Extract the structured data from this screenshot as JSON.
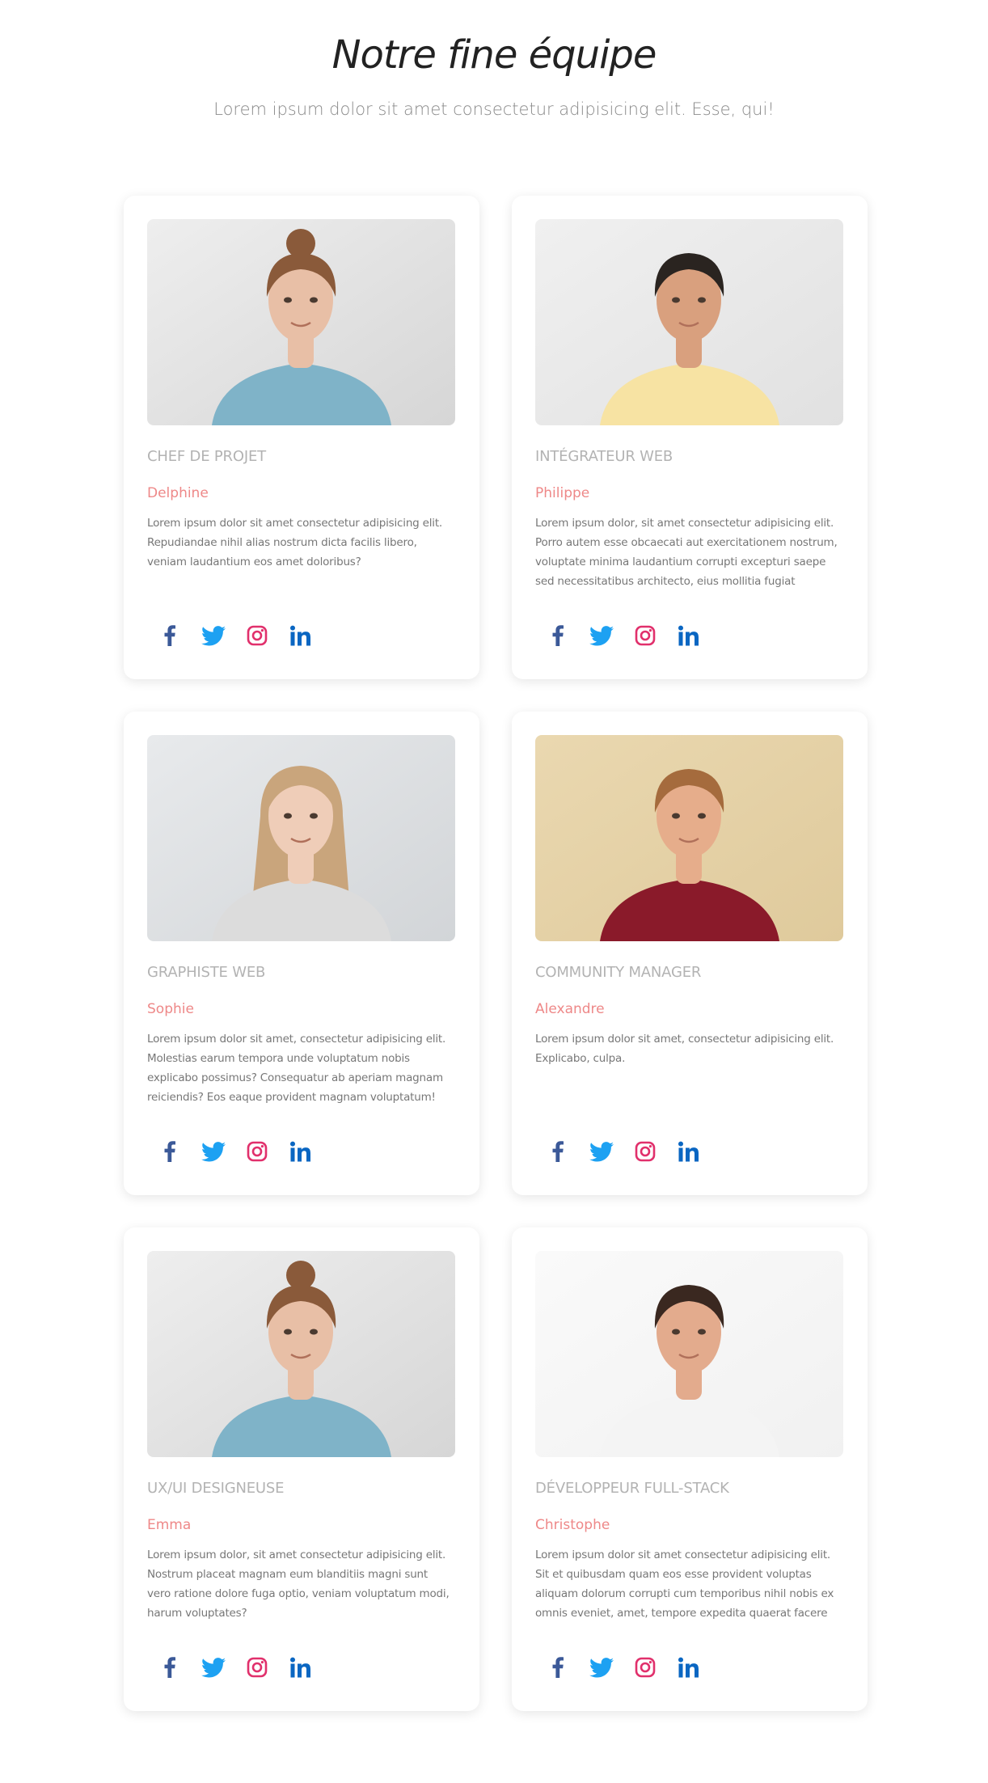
{
  "header": {
    "title": "Notre fine équipe",
    "subtitle": "Lorem ipsum dolor sit amet consectetur adipisicing elit. Esse, qui!"
  },
  "colors": {
    "role": "#b3b3b3",
    "name": "#ee8888",
    "facebook": "#3b5998",
    "twitter": "#1da1f2",
    "instagram": "#e1306c",
    "linkedin": "#0a66c2"
  },
  "social_icons": [
    "facebook-icon",
    "twitter-icon",
    "instagram-icon",
    "linkedin-icon"
  ],
  "members": [
    {
      "role": "Chef de projet",
      "name": "Delphine",
      "description": "Lorem ipsum dolor sit amet consectetur adipisicing elit. Repudiandae nihil alias nostrum dicta facilis libero, veniam laudantium eos amet doloribus?",
      "photo": "woman-portrait-bun"
    },
    {
      "role": "Intégrateur web",
      "name": "Philippe",
      "description": "Lorem ipsum dolor, sit amet consectetur adipisicing elit. Porro autem esse obcaecati aut exercitationem nostrum, voluptate minima laudantium corrupti excepturi saepe sed necessitatibus architecto, eius mollitia fugiat",
      "photo": "man-portrait-yellow-shirt"
    },
    {
      "role": "Graphiste web",
      "name": "Sophie",
      "description": "Lorem ipsum dolor sit amet, consectetur adipisicing elit. Molestias earum tempora unde voluptatum nobis explicabo possimus? Consequatur ab aperiam magnam reiciendis? Eos eaque provident magnam voluptatum!",
      "photo": "woman-portrait-long-hair"
    },
    {
      "role": "Community manager",
      "name": "Alexandre",
      "description": "Lorem ipsum dolor sit amet, consectetur adipisicing elit. Explicabo, culpa.",
      "photo": "man-portrait-red-shirt"
    },
    {
      "role": "UX/UI designeuse",
      "name": "Emma",
      "description": "Lorem ipsum dolor, sit amet consectetur adipisicing elit. Nostrum placeat magnam eum blanditiis magni sunt vero ratione dolore fuga optio, veniam voluptatum modi, harum voluptates?",
      "photo": "woman-portrait-bun"
    },
    {
      "role": "Développeur full-stack",
      "name": "Christophe",
      "description": "Lorem ipsum dolor sit amet consectetur adipisicing elit. Sit et quibusdam quam eos esse provident voluptas aliquam dolorum corrupti cum temporibus nihil nobis ex omnis eveniet, amet, tempore expedita quaerat facere",
      "photo": "man-portrait-white-shirt"
    }
  ]
}
